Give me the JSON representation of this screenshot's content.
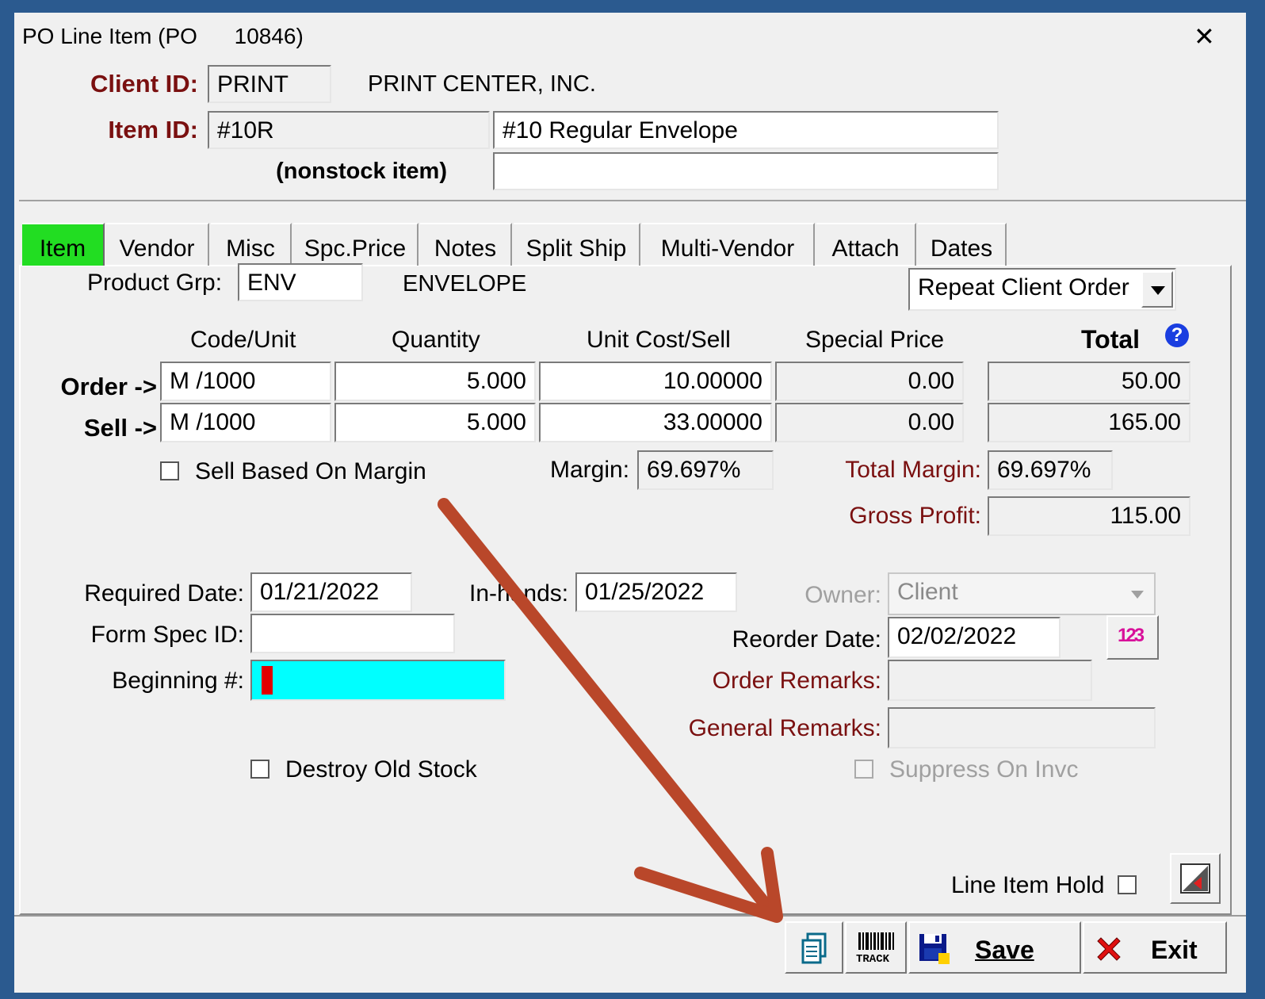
{
  "window": {
    "title": "PO Line Item (PO      10846)",
    "close_label": "✕"
  },
  "header": {
    "client_id_label": "Client ID:",
    "client_id": "PRINT",
    "client_name": "PRINT CENTER, INC.",
    "item_id_label": "Item ID:",
    "item_id": "#10R",
    "item_description": "#10 Regular Envelope",
    "nonstock_label": "(nonstock item)",
    "nonstock_value": ""
  },
  "tabs": [
    {
      "label": "Item",
      "active": true
    },
    {
      "label": "Vendor"
    },
    {
      "label": "Misc"
    },
    {
      "label": "Spc.Price"
    },
    {
      "label": "Notes"
    },
    {
      "label": "Split Ship"
    },
    {
      "label": "Multi-Vendor"
    },
    {
      "label": "Attach"
    },
    {
      "label": "Dates"
    }
  ],
  "item_tab": {
    "product_grp_label": "Product Grp:",
    "product_grp": "ENV",
    "product_grp_name": "ENVELOPE",
    "order_type": "Repeat Client Order",
    "columns": {
      "code_unit": "Code/Unit",
      "quantity": "Quantity",
      "unit_cost_sell": "Unit Cost/Sell",
      "special_price": "Special Price",
      "total": "Total"
    },
    "order": {
      "label": "Order ->",
      "code_unit": "M /1000",
      "quantity": "5.000",
      "unit_cost": "10.00000",
      "special_price": "0.00",
      "total": "50.00"
    },
    "sell": {
      "label": "Sell ->",
      "code_unit": "M /1000",
      "quantity": "5.000",
      "unit_cost": "33.00000",
      "special_price": "0.00",
      "total": "165.00"
    },
    "sell_based_on_margin_label": "Sell Based On Margin",
    "margin_label": "Margin:",
    "margin": "69.697%",
    "total_margin_label": "Total Margin:",
    "total_margin": "69.697%",
    "gross_profit_label": "Gross Profit:",
    "gross_profit": "115.00",
    "required_date_label": "Required Date:",
    "required_date": "01/21/2022",
    "in_hands_label": "In-hands:",
    "in_hands": "01/25/2022",
    "owner_label": "Owner:",
    "owner": "Client",
    "form_spec_id_label": "Form Spec ID:",
    "form_spec_id": "",
    "reorder_date_label": "Reorder Date:",
    "reorder_date": "02/02/2022",
    "beginning_label": "Beginning #:",
    "beginning": "",
    "order_remarks_label": "Order Remarks:",
    "order_remarks": "",
    "general_remarks_label": "General Remarks:",
    "general_remarks": "",
    "destroy_old_stock_label": "Destroy Old Stock",
    "suppress_on_invc_label": "Suppress On Invc",
    "line_item_hold_label": "Line Item Hold"
  },
  "toolbar": {
    "save_label": "Save",
    "exit_label": "Exit",
    "track_label": "TRACK",
    "numbers_icon_text": "123"
  },
  "colors": {
    "active_tab": "#22dd22",
    "highlight_field": "#00ffff",
    "maroon_label": "#7a1010",
    "arrow": "#b9472a"
  }
}
